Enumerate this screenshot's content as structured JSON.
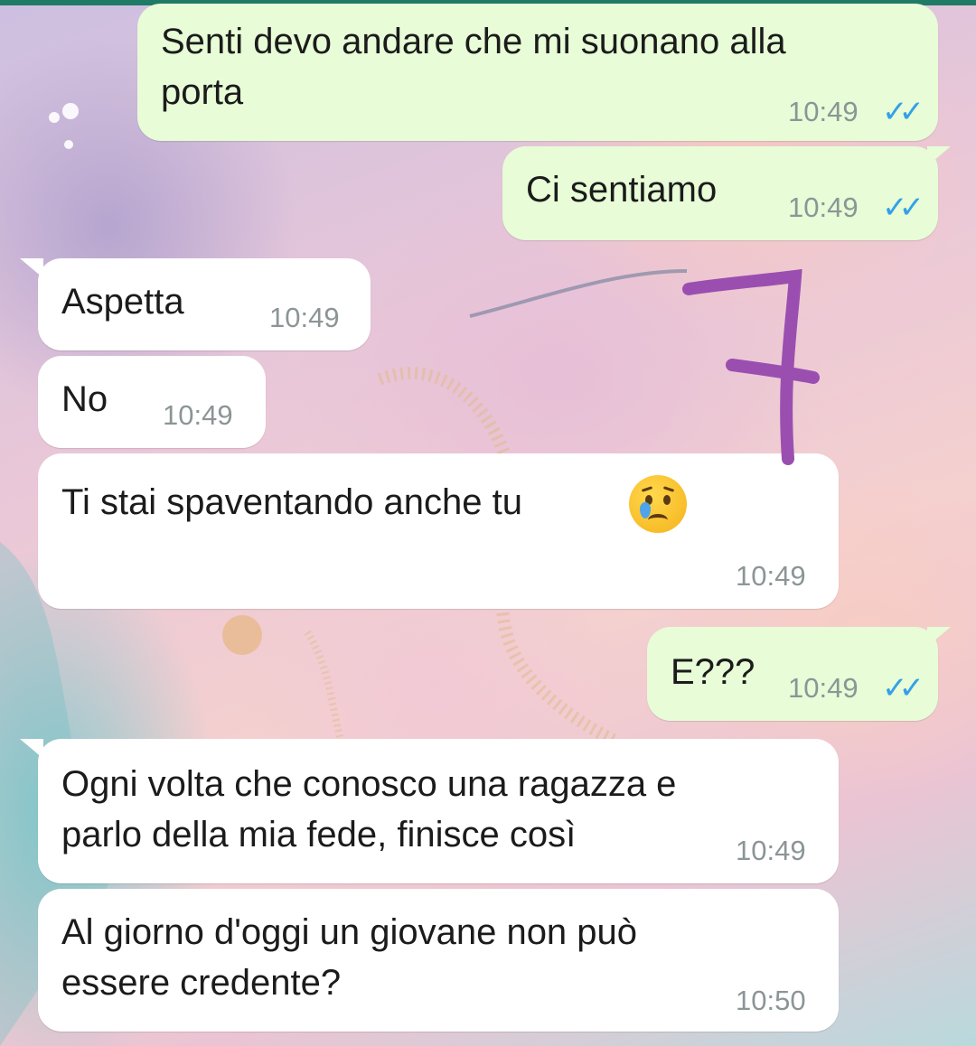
{
  "chat": {
    "messages": [
      {
        "dir": "out",
        "text": "Senti devo andare che mi suonano alla\nporta",
        "time": "10:49",
        "ticks": "✓✓"
      },
      {
        "dir": "out",
        "text": "Ci sentiamo",
        "time": "10:49",
        "ticks": "✓✓"
      },
      {
        "dir": "in",
        "text": "Aspetta",
        "time": "10:49"
      },
      {
        "dir": "in",
        "text": "No",
        "time": "10:49"
      },
      {
        "dir": "in",
        "text": "Ti stai spaventando anche tu",
        "time": "10:49",
        "emoji": "crying-face-emoji"
      },
      {
        "dir": "out",
        "text": "E???",
        "time": "10:49",
        "ticks": "✓✓"
      },
      {
        "dir": "in",
        "text": "Ogni volta che conosco una ragazza e\nparlo della mia fede, finisce così",
        "time": "10:49"
      },
      {
        "dir": "in",
        "text": "Al giorno d'oggi un giovane non può\nessere credente?",
        "time": "10:50"
      }
    ]
  },
  "annotation": {
    "glyph": "7",
    "color": "#9a4fb0"
  },
  "colors": {
    "outgoing_bubble": "#e7fcd7",
    "incoming_bubble": "#ffffff",
    "read_ticks": "#35a0e8",
    "top_bar": "#1f7a66"
  }
}
